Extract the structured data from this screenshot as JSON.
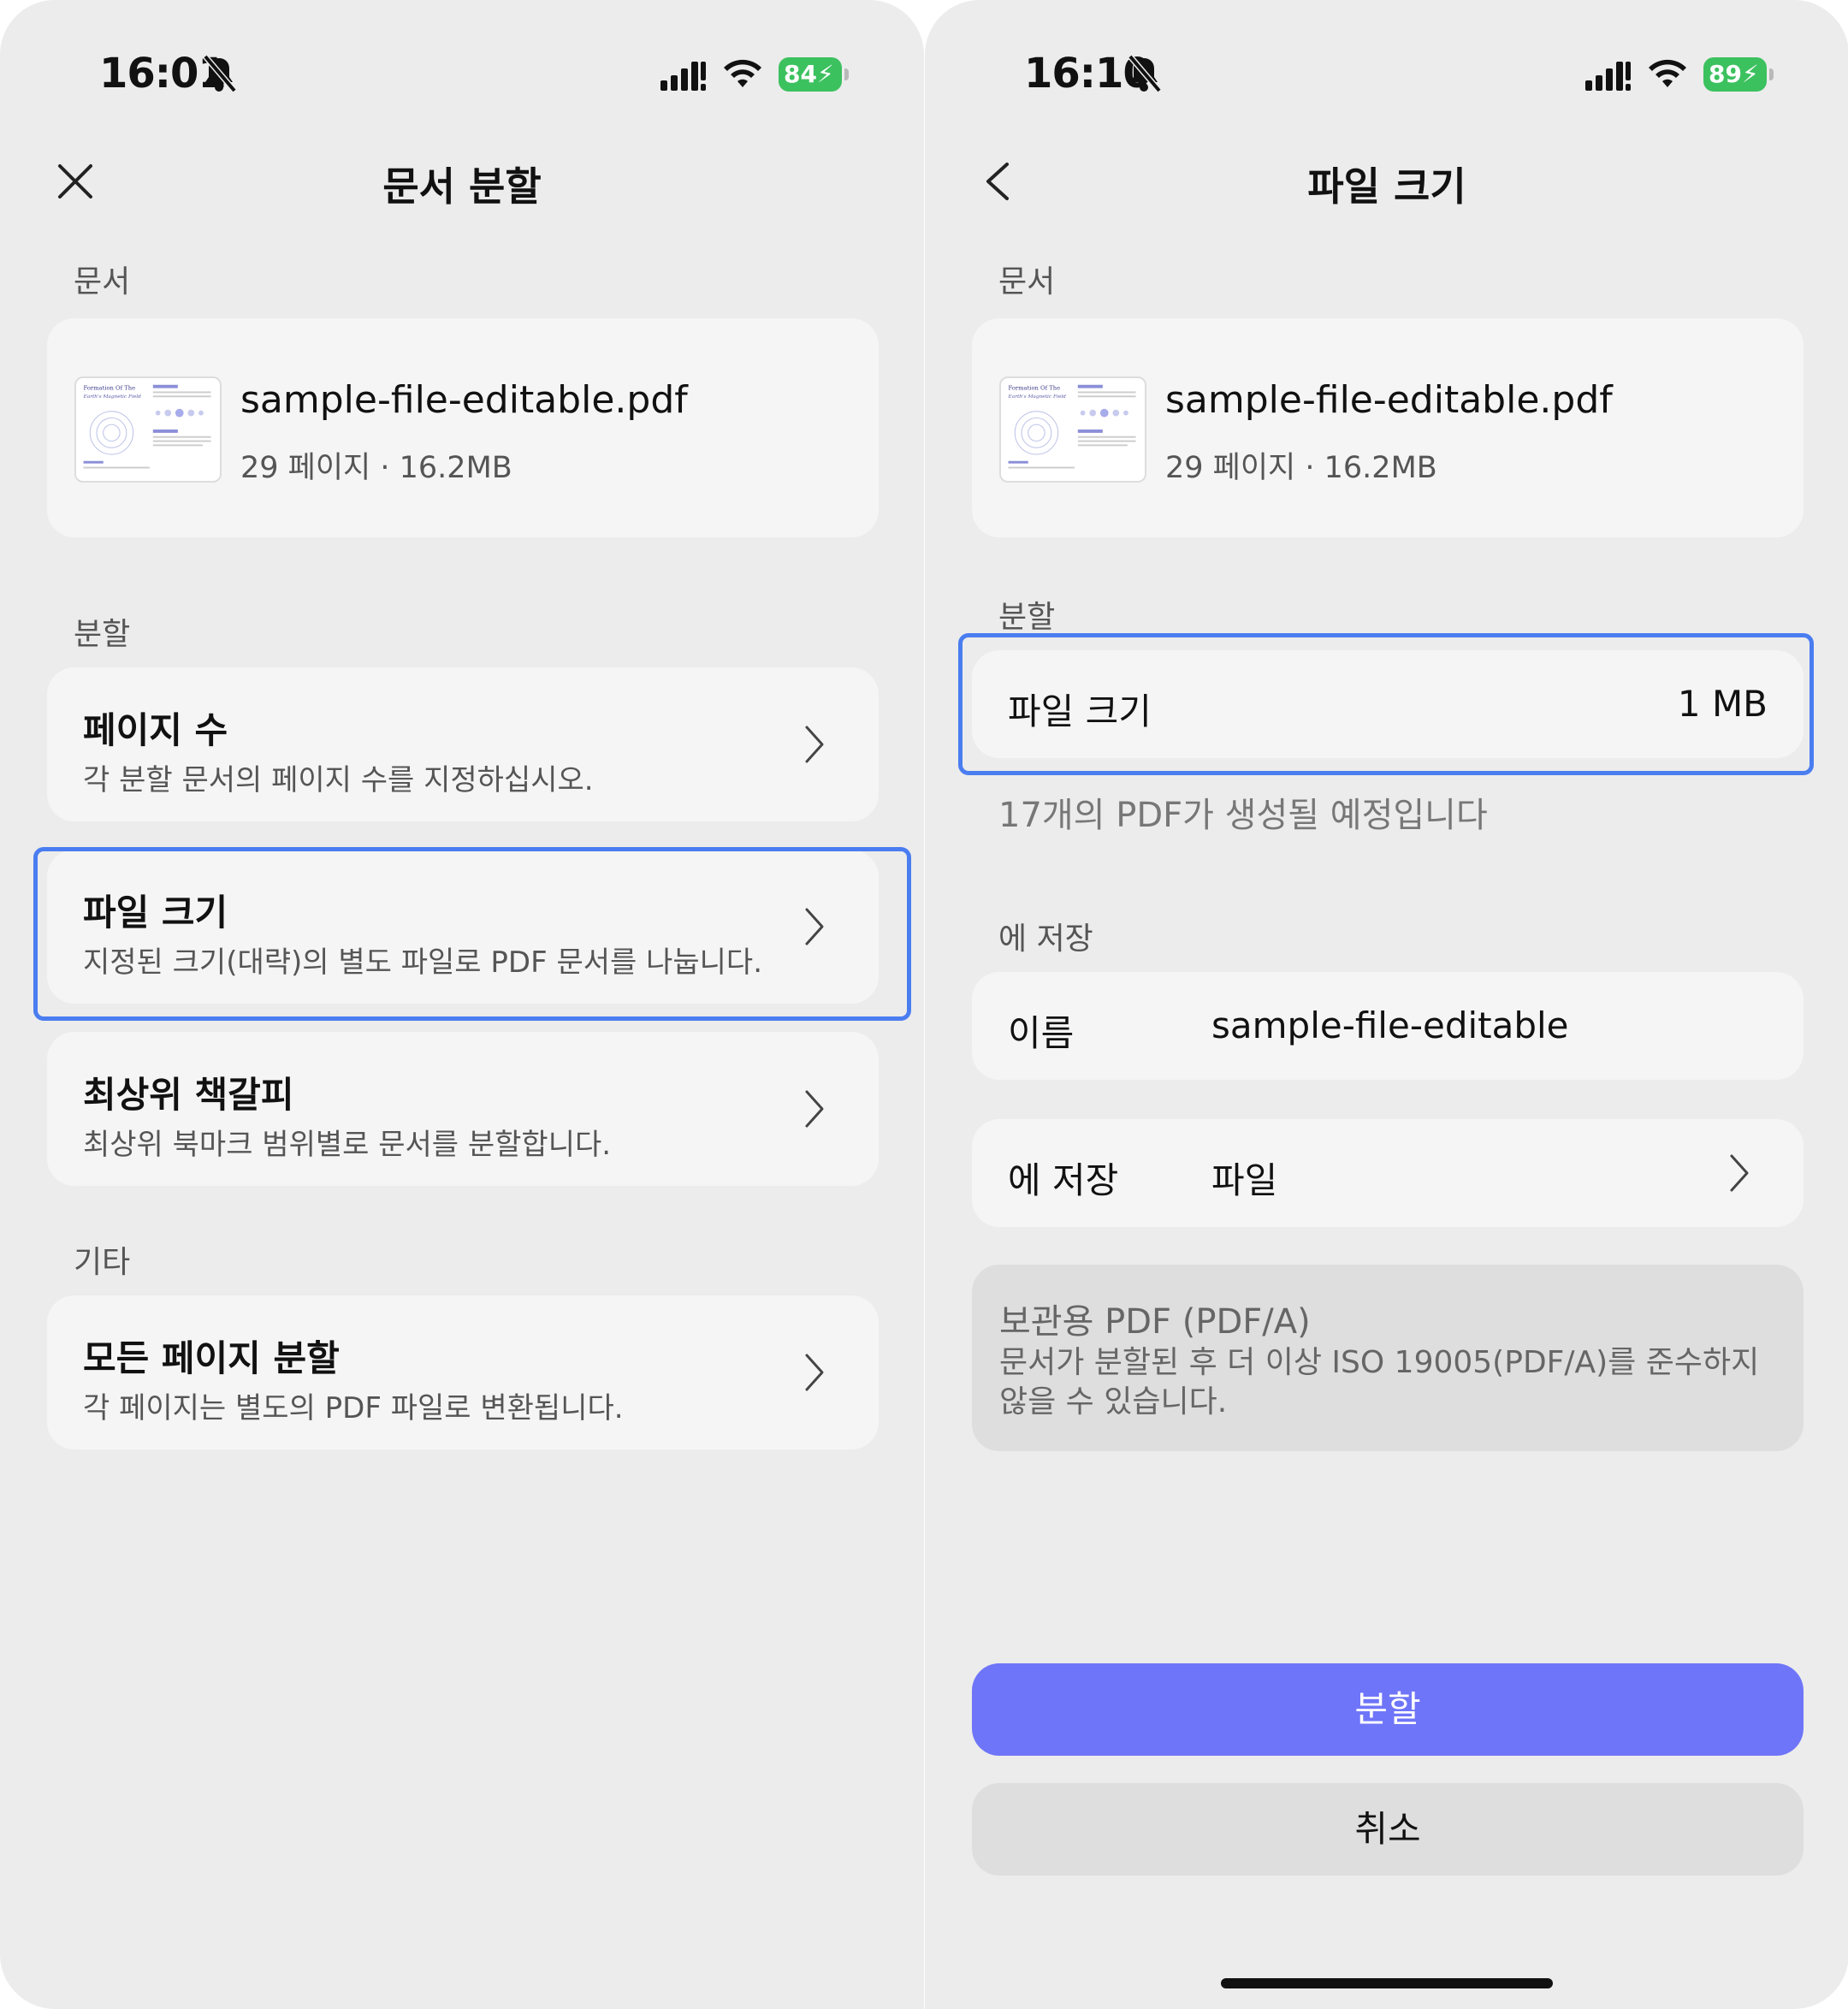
{
  "left": {
    "status": {
      "time": "16:01",
      "battery": "84"
    },
    "nav": {
      "title": "문서 분할"
    },
    "doc_section": "문서",
    "document": {
      "name": "sample-file-editable.pdf",
      "meta": "29 페이지 · 16.2MB"
    },
    "split_section": "분할",
    "options": [
      {
        "title": "페이지 수",
        "desc": "각 분할 문서의 페이지 수를 지정하십시오."
      },
      {
        "title": "파일 크기",
        "desc": "지정된 크기(대략)의 별도 파일로 PDF 문서를 나눕니다."
      },
      {
        "title": "최상위 책갈피",
        "desc": "최상위 북마크 범위별로 문서를 분할합니다."
      }
    ],
    "other_section": "기타",
    "other_option": {
      "title": "모든 페이지 분할",
      "desc": "각 페이지는 별도의 PDF 파일로 변환됩니다."
    }
  },
  "right": {
    "status": {
      "time": "16:10",
      "battery": "89"
    },
    "nav": {
      "title": "파일 크기"
    },
    "doc_section": "문서",
    "document": {
      "name": "sample-file-editable.pdf",
      "meta": "29 페이지 · 16.2MB"
    },
    "split_section": "분할",
    "file_size": {
      "label": "파일 크기",
      "value": "1 MB"
    },
    "pdf_count_note": "17개의 PDF가 생성될 예정입니다",
    "save_section": "에 저장",
    "name_row": {
      "label": "이름",
      "value": "sample-file-editable"
    },
    "save_row": {
      "label": "에 저장",
      "value": "파일"
    },
    "archive": {
      "title": "보관용 PDF (PDF/A)",
      "desc": "문서가 분할된 후 더 이상 ISO 19005(PDF/A)를 준수하지 않을 수 있습니다."
    },
    "buttons": {
      "split": "분할",
      "cancel": "취소"
    }
  },
  "thumbnail_text": {
    "line1": "Formation Of The",
    "line2": "Earth's Magnetic Field"
  },
  "icons": {
    "close": "close-icon",
    "back": "chevron-left-icon",
    "chevron": "chevron-right-icon",
    "bell": "bell-slash-icon",
    "signal": "cellular-signal-icon",
    "wifi": "wifi-icon",
    "battery": "battery-charging-icon"
  },
  "colors": {
    "accent": "#6f75f8",
    "highlight": "#4a7df0",
    "battery": "#3cc15f",
    "background": "#ececec",
    "card": "#f5f5f5"
  }
}
